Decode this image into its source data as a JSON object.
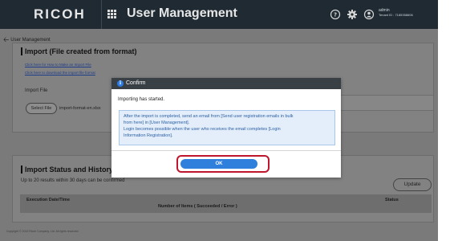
{
  "header": {
    "logo": "RICOH",
    "title": "User Management",
    "icons": [
      "help-icon",
      "gear-icon",
      "user-icon"
    ],
    "user_name": "admin",
    "tenant": "Tenant ID : 7185358606"
  },
  "breadcrumb": {
    "label": "User Management"
  },
  "import_section": {
    "title": "Import (File created from format)",
    "link_how_to": "Click here for How to Make an Import File",
    "link_download": "Click here to download the import file format",
    "file_label": "Import File",
    "select_label": "Select File",
    "file_name": "import-format-en.xlsx"
  },
  "status_section": {
    "title": "Import Status and History",
    "note": "Up to 20 results within 30 days can be confirmed",
    "update_label": "Update",
    "columns": [
      "Execution Date/Time",
      "Number of Items ( Succeeded / Error )",
      "Status"
    ]
  },
  "footer": {
    "copyright": "Copyright © 2019 Ricoh Company, Ltd. All rights reserved."
  },
  "dialog": {
    "title": "Confirm",
    "message": "Importing has started.",
    "note_lines": [
      "After the import is completed, send an email from [Send user registration emails in bulk",
      "from here] in [User Management].",
      "Login becomes possible when the user who receives the email completes [Login",
      "Information Registration]."
    ],
    "ok_label": "OK"
  },
  "colors": {
    "accent": "#2f7fdd",
    "highlight": "#c0162d",
    "header": "#1f2a33"
  }
}
